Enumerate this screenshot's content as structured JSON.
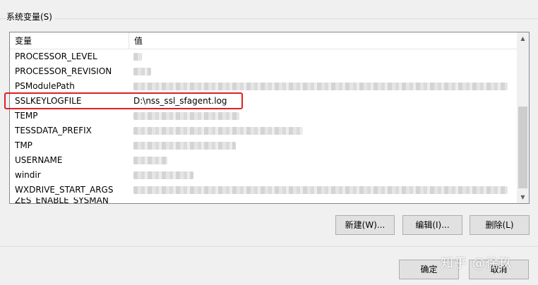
{
  "group": {
    "label": "系统变量(S)"
  },
  "table": {
    "columns": [
      "变量",
      "值"
    ],
    "rows": [
      {
        "name": "PROCESSOR_LEVEL",
        "value": ""
      },
      {
        "name": "PROCESSOR_REVISION",
        "value": ""
      },
      {
        "name": "PSModulePath",
        "value": ""
      },
      {
        "name": "SSLKEYLOGFILE",
        "value": "D:\\nss_ssl_sfagent.log"
      },
      {
        "name": "TEMP",
        "value": ""
      },
      {
        "name": "TESSDATA_PREFIX",
        "value": ""
      },
      {
        "name": "TMP",
        "value": ""
      },
      {
        "name": "USERNAME",
        "value": ""
      },
      {
        "name": "windir",
        "value": ""
      },
      {
        "name": "WXDRIVE_START_ARGS",
        "value": ""
      },
      {
        "name": "ZES_ENABLE_SYSMAN",
        "value": ""
      }
    ]
  },
  "buttons": {
    "new": "新建(W)...",
    "edit": "编辑(I)...",
    "delete": "删除(L)",
    "ok": "确定",
    "cancel": "取消"
  },
  "watermark": "知乎 @徐玖",
  "colors": {
    "highlight": "#e02020"
  },
  "icons": {
    "scroll_up": "chevron-up-icon",
    "scroll_down": "chevron-down-icon"
  }
}
